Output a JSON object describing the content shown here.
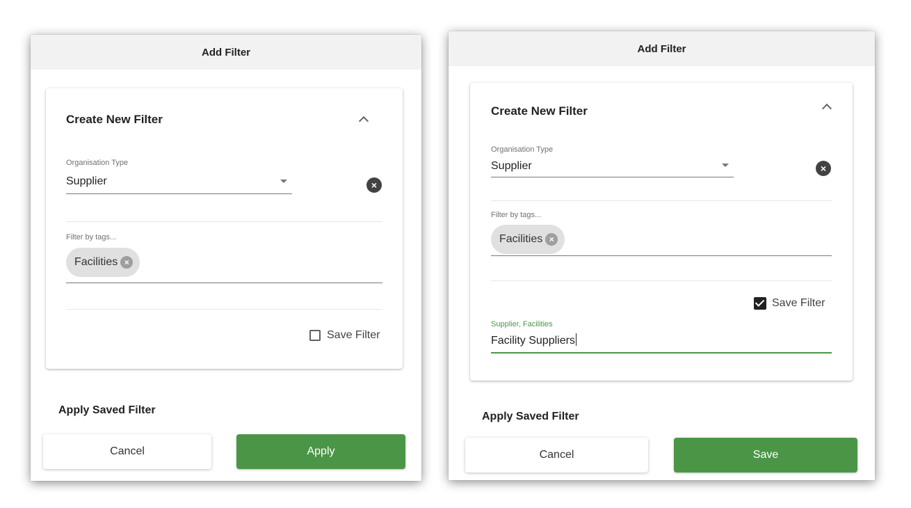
{
  "colors": {
    "accent": "#4b9646",
    "header_bg": "#f2f2f2",
    "chip_bg": "#e0e0e0"
  },
  "dialog_left": {
    "header_title": "Add Filter",
    "card_title": "Create New Filter",
    "org_type": {
      "label": "Organisation Type",
      "value": "Supplier"
    },
    "tags": {
      "label": "Filter by tags...",
      "chips": [
        "Facilities"
      ]
    },
    "save_filter": {
      "label": "Save Filter",
      "checked": false
    },
    "saved_section_title": "Apply Saved Filter",
    "cancel_label": "Cancel",
    "primary_label": "Apply"
  },
  "dialog_right": {
    "header_title": "Add Filter",
    "card_title": "Create New Filter",
    "org_type": {
      "label": "Organisation Type",
      "value": "Supplier"
    },
    "tags": {
      "label": "Filter by tags...",
      "chips": [
        "Facilities"
      ]
    },
    "save_filter": {
      "label": "Save Filter",
      "checked": true
    },
    "filter_name": {
      "label": "Supplier, Facilities",
      "value": "Facility Suppliers"
    },
    "saved_section_title": "Apply Saved Filter",
    "cancel_label": "Cancel",
    "primary_label": "Save"
  }
}
